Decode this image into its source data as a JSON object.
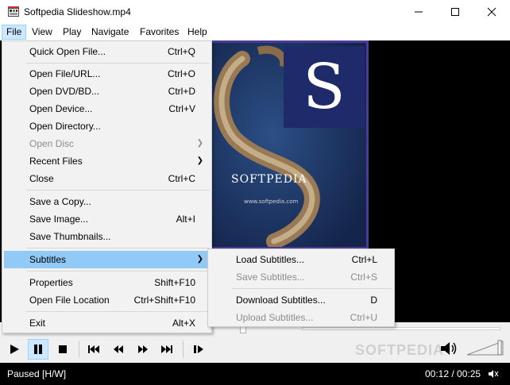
{
  "window": {
    "title": "Softpedia Slideshow.mp4",
    "controls": [
      "minimize-icon",
      "maximize-icon",
      "close-icon"
    ]
  },
  "menubar": {
    "items": [
      {
        "label": "File"
      },
      {
        "label": "View"
      },
      {
        "label": "Play"
      },
      {
        "label": "Navigate"
      },
      {
        "label": "Favorites"
      },
      {
        "label": "Help"
      }
    ]
  },
  "file_menu": {
    "items": [
      {
        "label": "Quick Open File...",
        "shortcut": "Ctrl+Q"
      },
      {
        "label": "Open File/URL...",
        "shortcut": "Ctrl+O"
      },
      {
        "label": "Open DVD/BD...",
        "shortcut": "Ctrl+D"
      },
      {
        "label": "Open Device...",
        "shortcut": "Ctrl+V"
      },
      {
        "label": "Open Directory...",
        "shortcut": ""
      },
      {
        "label": "Open Disc",
        "shortcut": "",
        "disabled": true,
        "submenu": true
      },
      {
        "label": "Recent Files",
        "shortcut": "",
        "submenu": true
      },
      {
        "label": "Close",
        "shortcut": "Ctrl+C"
      },
      {
        "label": "Save a Copy...",
        "shortcut": ""
      },
      {
        "label": "Save Image...",
        "shortcut": "Alt+I"
      },
      {
        "label": "Save Thumbnails...",
        "shortcut": ""
      },
      {
        "label": "Subtitles",
        "shortcut": "",
        "submenu": true,
        "highlighted": true
      },
      {
        "label": "Properties",
        "shortcut": "Shift+F10"
      },
      {
        "label": "Open File Location",
        "shortcut": "Ctrl+Shift+F10"
      },
      {
        "label": "Exit",
        "shortcut": "Alt+X"
      }
    ]
  },
  "subtitles_menu": {
    "items": [
      {
        "label": "Load Subtitles...",
        "shortcut": "Ctrl+L"
      },
      {
        "label": "Save Subtitles...",
        "shortcut": "Ctrl+S",
        "disabled": true
      },
      {
        "label": "Download Subtitles...",
        "shortcut": "D"
      },
      {
        "label": "Upload Subtitles...",
        "shortcut": "Ctrl+U",
        "disabled": true
      }
    ]
  },
  "video": {
    "overlay_text": "SOFTPEDIA",
    "url_text": "www.softpedia.com",
    "logo_letter": "S"
  },
  "playback": {
    "progress_fraction": 0.48,
    "controls": [
      "play-icon",
      "pause-icon",
      "stop-icon",
      "skip-back-icon",
      "rewind-icon",
      "fast-forward-icon",
      "skip-forward-icon",
      "frame-step-icon"
    ],
    "pause_pressed": true
  },
  "watermark": "SOFTPEDIA",
  "status": {
    "state": "Paused [H/W]",
    "time": "00:12 / 00:25"
  },
  "colors": {
    "menu_highlight": "#91c9f7",
    "active_menu": "#cce8ff",
    "video_border": "#4a3b99",
    "logo_bg": "#1f2a6b"
  }
}
